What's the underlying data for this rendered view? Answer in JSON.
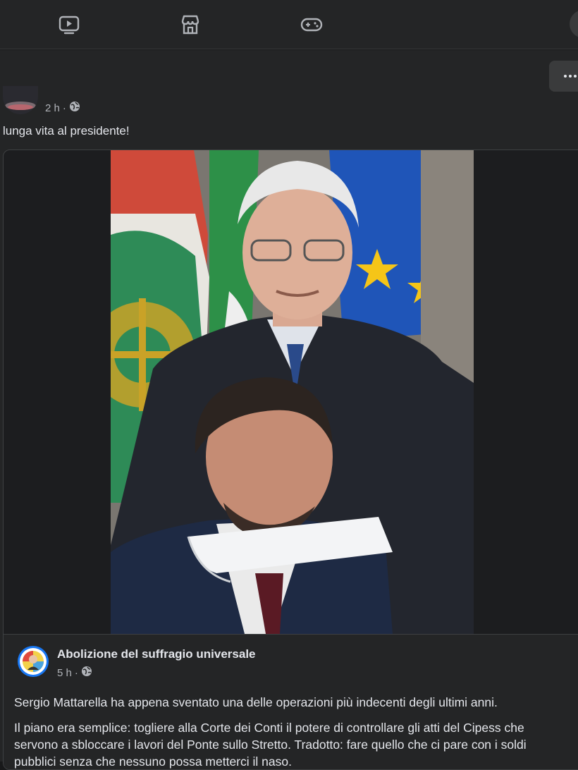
{
  "topbar": {
    "icons": [
      {
        "name": "video-watch-icon"
      },
      {
        "name": "marketplace-icon"
      },
      {
        "name": "gaming-icon"
      }
    ]
  },
  "post": {
    "time": "2 h",
    "separator": "·",
    "audience_icon": "globe-icon",
    "text": "lunga vita al presidente!"
  },
  "shared": {
    "page_name": "Abolizione del suffragio universale",
    "time": "5 h",
    "separator": "·",
    "audience_icon": "globe-icon",
    "paragraph1": "Sergio Mattarella ha appena sventato una delle operazioni più indecenti degli ultimi anni.",
    "paragraph2": "Il piano era semplice: togliere alla Corte dei Conti il potere di controllare gli atti del Cipess che servono a sbloccare i lavori del Ponte sullo Stretto. Tradotto: fare quello che ci pare con i soldi pubblici senza che nessuno possa metterci il naso."
  }
}
